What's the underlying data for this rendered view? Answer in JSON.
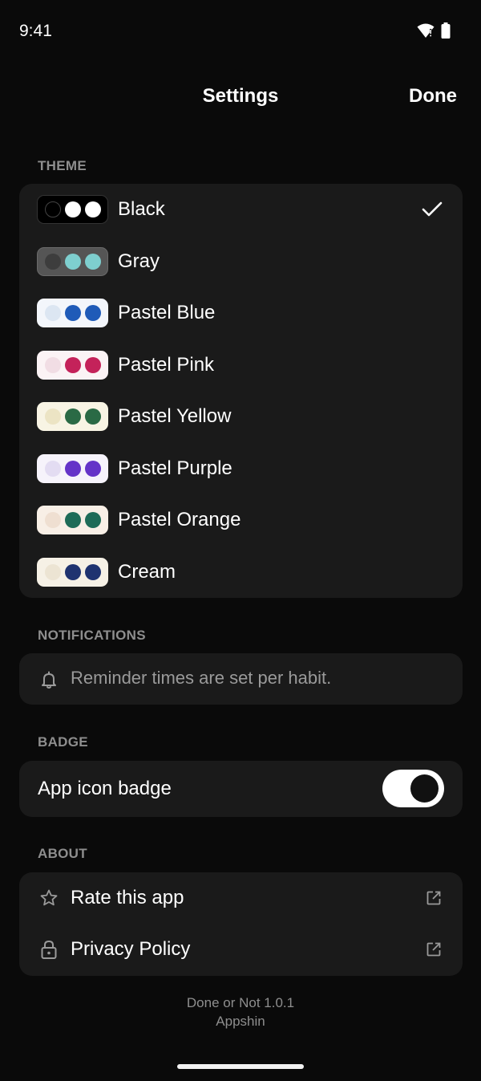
{
  "status_bar": {
    "time": "9:41"
  },
  "nav": {
    "title": "Settings",
    "done_label": "Done"
  },
  "sections": {
    "theme": "THEME",
    "notifications": "NOTIFICATIONS",
    "badge": "BADGE",
    "about": "ABOUT"
  },
  "themes": [
    {
      "label": "Black",
      "selected": true,
      "swatch_bg": "#000000",
      "swatch_border": "#333333",
      "dots": [
        "#000000",
        "#ffffff",
        "#ffffff"
      ]
    },
    {
      "label": "Gray",
      "selected": false,
      "swatch_bg": "#555555",
      "swatch_border": "#6a6a6a",
      "dots": [
        "#3d3d3d",
        "#7ecfcf",
        "#7ecfcf"
      ]
    },
    {
      "label": "Pastel Blue",
      "selected": false,
      "swatch_bg": "#f3f6fb",
      "swatch_border": "#f3f6fb",
      "dots": [
        "#dce6f2",
        "#1f5bb8",
        "#1f5bb8"
      ]
    },
    {
      "label": "Pastel Pink",
      "selected": false,
      "swatch_bg": "#fbf3f5",
      "swatch_border": "#fbf3f5",
      "dots": [
        "#f1dde4",
        "#c4225a",
        "#c4225a"
      ]
    },
    {
      "label": "Pastel Yellow",
      "selected": false,
      "swatch_bg": "#f8f4e4",
      "swatch_border": "#f8f4e4",
      "dots": [
        "#ece4c4",
        "#2a6a45",
        "#2a6a45"
      ]
    },
    {
      "label": "Pastel Purple",
      "selected": false,
      "swatch_bg": "#f6f3fb",
      "swatch_border": "#f6f3fb",
      "dots": [
        "#e3dcf2",
        "#6433c8",
        "#6433c8"
      ]
    },
    {
      "label": "Pastel Orange",
      "selected": false,
      "swatch_bg": "#f8efe6",
      "swatch_border": "#f8efe6",
      "dots": [
        "#efdfd1",
        "#1e6b57",
        "#1e6b57"
      ]
    },
    {
      "label": "Cream",
      "selected": false,
      "swatch_bg": "#f6f1e6",
      "swatch_border": "#f6f1e6",
      "dots": [
        "#ece4d3",
        "#1f3370",
        "#1f3370"
      ]
    }
  ],
  "notifications": {
    "text": "Reminder times are set per habit.",
    "icon": "bell-icon"
  },
  "badge": {
    "label": "App icon badge",
    "enabled": true
  },
  "about": {
    "rate_label": "Rate this app",
    "rate_icon": "star-icon",
    "privacy_label": "Privacy Policy",
    "privacy_icon": "lock-icon"
  },
  "footer": {
    "version": "Done or Not 1.0.1",
    "developer": "Appshin"
  }
}
